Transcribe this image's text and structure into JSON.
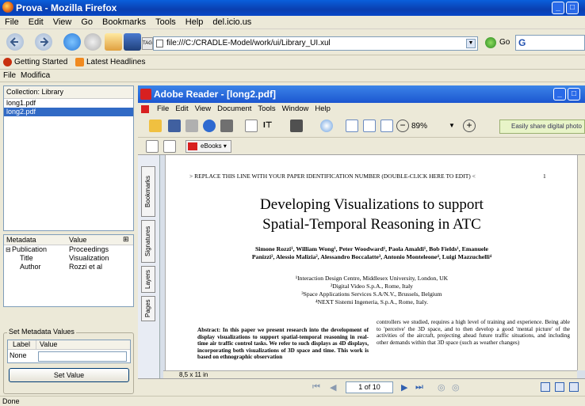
{
  "window": {
    "title": "Prova - Mozilla Firefox"
  },
  "menu": [
    "File",
    "Edit",
    "View",
    "Go",
    "Bookmarks",
    "Tools",
    "Help",
    "del.icio.us"
  ],
  "nav": {
    "url": "file:///C:/CRADLE-Model/work/ui/Library_UI.xul",
    "go_label": "Go"
  },
  "bookmarks": {
    "getting_started": "Getting Started",
    "latest_headlines": "Latest Headlines"
  },
  "xul_menu": {
    "file": "File",
    "modify": "Modifica"
  },
  "library": {
    "header": "Collection: Library",
    "items": [
      "long1.pdf",
      "long2.pdf"
    ],
    "selected_index": 1
  },
  "metadata": {
    "col_metadata": "Metadata",
    "col_value": "Value",
    "rows": [
      {
        "name": "Publication",
        "value": "Proceedings"
      },
      {
        "name": "Title",
        "value": "Visualization"
      },
      {
        "name": "Author",
        "value": "Rozzi et al"
      }
    ]
  },
  "set_metadata": {
    "legend": "Set Metadata Values",
    "label_header": "Label",
    "value_header": "Value",
    "label_value": "None",
    "value_value": "",
    "button": "Set Value"
  },
  "reader": {
    "title": "Adobe Reader - [long2.pdf]",
    "menu": [
      "File",
      "Edit",
      "View",
      "Document",
      "Tools",
      "Window",
      "Help"
    ],
    "zoom": "89%",
    "share": "Easily share digital photo",
    "ebooks": "eBooks",
    "tabs": [
      "Bookmarks",
      "Signatures",
      "Layers",
      "Pages"
    ],
    "page_size": "8,5 x 11 in",
    "page_counter": "1 of 10"
  },
  "pdf": {
    "header": "> REPLACE THIS LINE WITH YOUR PAPER IDENTIFICATION NUMBER (DOUBLE-CLICK HERE TO EDIT) <",
    "page_num": "1",
    "title_line1": "Developing Visualizations to support",
    "title_line2": "Spatial-Temporal Reasoning in ATC",
    "authors_line1": "Simone Rozzi¹, William Wong¹, Peter Woodward¹, Paola Amaldi¹, Bob Fields¹, Emanuele",
    "authors_line2": "Panizzi², Alessio Malizia², Alessandro Boccalatte³, Antonio Monteleone⁴, Luigi Mazzuchelli⁴",
    "aff1": "¹Interaction Design Centre, Middlesex University, London, UK",
    "aff2": "²Digital Video S.p.A., Rome, Italy",
    "aff3": "³Space Applications Services S.A/N.V., Brussels, Belgium",
    "aff4": "⁴NEXT Sistemi Ingeneria, S.p.A., Rome, Italy.",
    "abstract_left": "Abstract: In this paper we present research into the development of display visualizations to support spatial-temporal reasoning in real-time air traffic control tasks. We refer to such displays as 4D displays, incorporating both visualizations of 3D space and time. This work is based on ethnographic observation",
    "abstract_right": "controllers we studied, requires a high level of training and experience. Being able to 'perceive' the 3D space, and to then develop a good 'mental picture' of the activities of the aircraft, projecting ahead future traffic situations, and including other demands within that 3D space (such as weather changes)"
  },
  "status": "Done"
}
